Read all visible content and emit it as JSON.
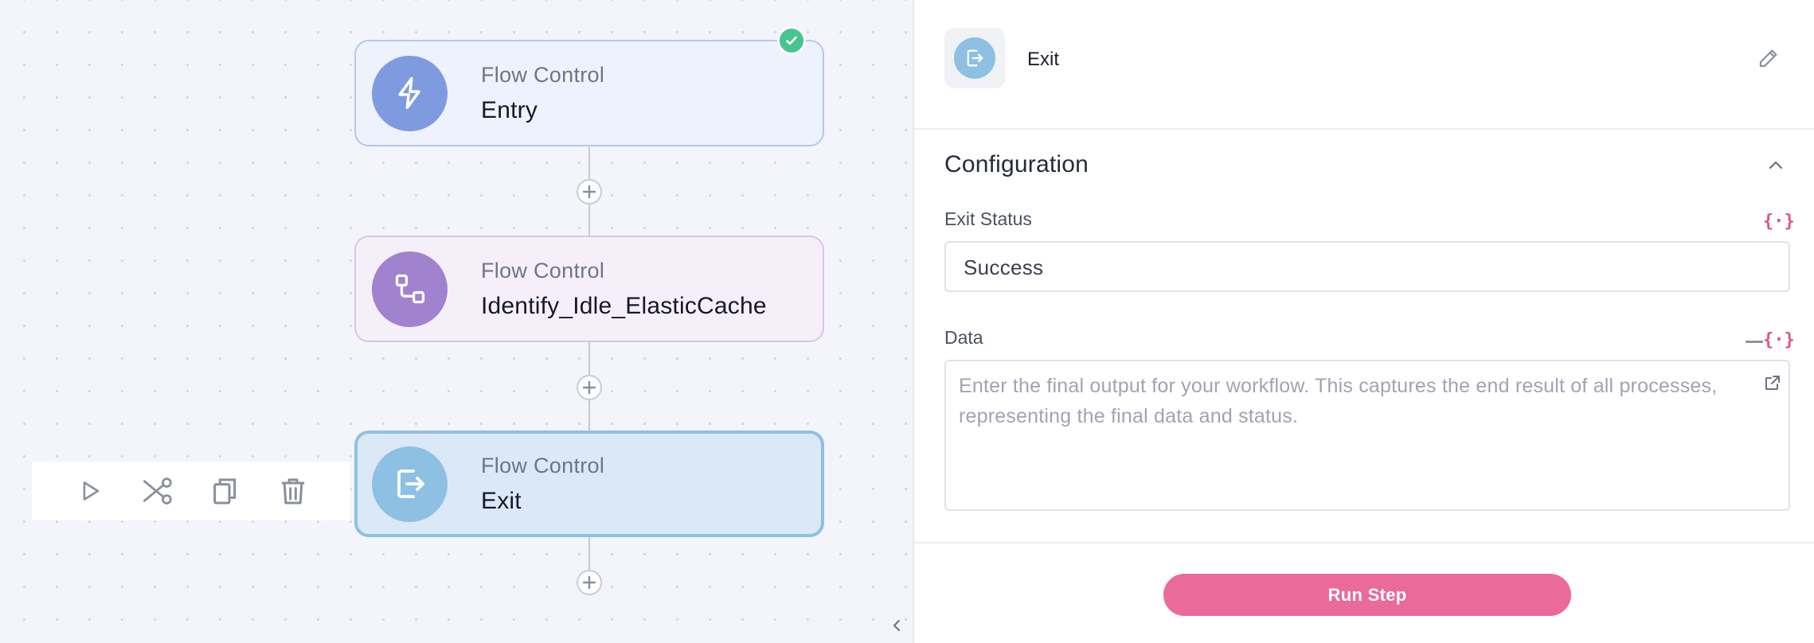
{
  "canvas": {
    "nodes": [
      {
        "category": "Flow Control",
        "name": "Entry",
        "icon": "lightning-icon",
        "color": "#7f9be0",
        "status": "success"
      },
      {
        "category": "Flow Control",
        "name": "Identify_Idle_ElasticCache",
        "icon": "workflow-icon",
        "color": "#a182cf"
      },
      {
        "category": "Flow Control",
        "name": "Exit",
        "icon": "exit-icon",
        "color": "#8ec0e3",
        "selected": true
      }
    ],
    "toolbar": [
      "play-icon",
      "shuffle-icon",
      "copy-icon",
      "trash-icon"
    ]
  },
  "panel": {
    "title": "Exit",
    "section_title": "Configuration",
    "exit_status": {
      "label": "Exit Status",
      "value": "Success",
      "var_button": "{·}"
    },
    "data": {
      "label": "Data",
      "placeholder": "Enter the final output for your workflow. This captures the end result of all processes, representing the final data and status.",
      "var_button": "{·}"
    },
    "run_button": "Run Step"
  },
  "colors": {
    "accent": "#ea6a9a",
    "success": "#47c48f",
    "selected_border": "#8ec0e3"
  }
}
